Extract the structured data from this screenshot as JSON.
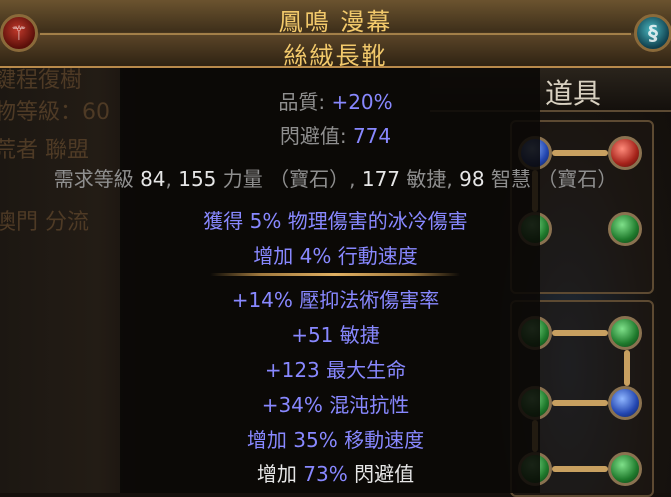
{
  "background": {
    "left_ghost_text": [
      "鍵程復樹",
      "物等級：60",
      "荒者 聯盟",
      "澳門 分流"
    ],
    "items_tab_label": "道具"
  },
  "header": {
    "item_name": "鳳鳴 漫幕",
    "item_base": "絲絨長靴",
    "name_color": "#f2c96b"
  },
  "properties": {
    "quality_label": "品質: ",
    "quality_value": "+20%",
    "evasion_label": "閃避值: ",
    "evasion_value": "774"
  },
  "requirements": {
    "prefix": "需求等級 ",
    "level": "84",
    "comma1": ", ",
    "str": "155",
    "str_label": " 力量 （寶石）, ",
    "dex": "177",
    "dex_label": " 敏捷, ",
    "int": "98",
    "int_label": " 智慧 （寶石）"
  },
  "implicit_mods": [
    {
      "pre": "獲得 ",
      "value": "5%",
      "post": " 物理傷害的冰冷傷害"
    },
    {
      "pre": "增加 ",
      "value": "4%",
      "post": " 行動速度"
    }
  ],
  "explicit_mods": [
    {
      "pre": "",
      "value": "+14%",
      "post": " 壓抑法術傷害率"
    },
    {
      "pre": "",
      "value": "+51",
      "post": " 敏捷"
    },
    {
      "pre": "",
      "value": "+123",
      "post": " 最大生命"
    },
    {
      "pre": "",
      "value": "+34%",
      "post": " 混沌抗性"
    },
    {
      "pre": "增加 ",
      "value": "35%",
      "post": " 移動速度"
    }
  ],
  "last_mod": {
    "pre": "增加 ",
    "value": "73%",
    "post": " 閃避值"
  },
  "colors": {
    "mod_blue": "#8888ff",
    "label_grey": "#8f8f8f",
    "white": "#e6e6e6"
  }
}
